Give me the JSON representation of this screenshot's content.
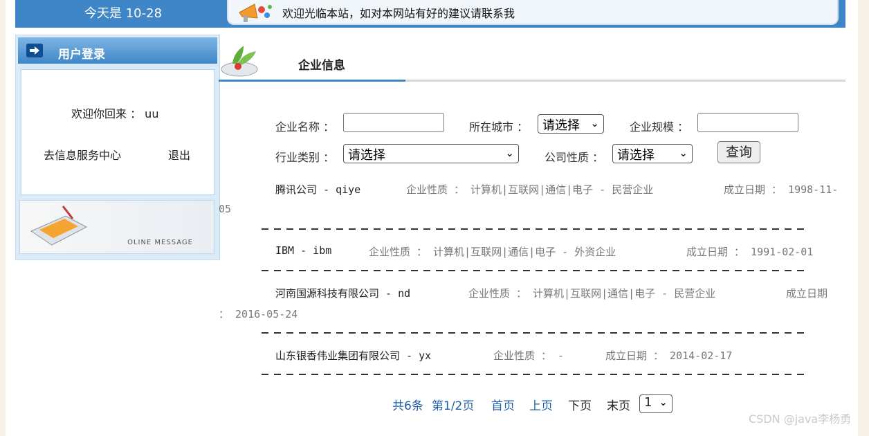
{
  "header": {
    "date_text": "今天是 10-28",
    "notice": "欢迎光临本站，如对本网站有好的建议请联系我"
  },
  "sidebar": {
    "title": "用户登录",
    "welcome": "欢迎你回来 ： uu",
    "service_link": "去信息服务中心",
    "logout_link": "退出",
    "banner_text": "OLINE MESSAGE"
  },
  "main": {
    "title": "企业信息",
    "search": {
      "name_label": "企业名称 ：",
      "name_value": "",
      "city_label": "所在城市 ：",
      "city_value": "请选择",
      "scale_label": "企业规模 ：",
      "scale_value": "",
      "industry_label": "行业类别 ：",
      "industry_value": "请选择",
      "nature_label": "公司性质 ：",
      "nature_value": "请选择",
      "query_button": "查询"
    },
    "rows": [
      {
        "name": "腾讯公司 - qiye",
        "nature": "企业性质 ： 计算机|互联网|通信|电子 - 民营企业",
        "date_a": "成立日期 ： 1998-11-",
        "date_b": "05"
      },
      {
        "name": "IBM - ibm",
        "nature": "企业性质 ： 计算机|互联网|通信|电子 - 外资企业",
        "date_a": "成立日期 ： 1991-02-01",
        "date_b": ""
      },
      {
        "name": "河南国源科技有限公司 - nd",
        "nature": "企业性质 ： 计算机|互联网|通信|电子 - 民营企业",
        "date_a": "成立日期",
        "date_b": "： 2016-05-24"
      },
      {
        "name": "山东银香伟业集团有限公司 - yx",
        "nature": "企业性质 ： -",
        "date_a": "成立日期 ： 2014-02-17",
        "date_b": ""
      }
    ],
    "pager": {
      "total": "共6条",
      "page": "第1/2页",
      "first": "首页",
      "prev": "上页",
      "next": "下页",
      "last": "末页",
      "current": "1"
    }
  },
  "watermark": "CSDN @java李杨勇",
  "colors": {
    "accent": "#3f86c8",
    "link": "#1f5ea8"
  }
}
